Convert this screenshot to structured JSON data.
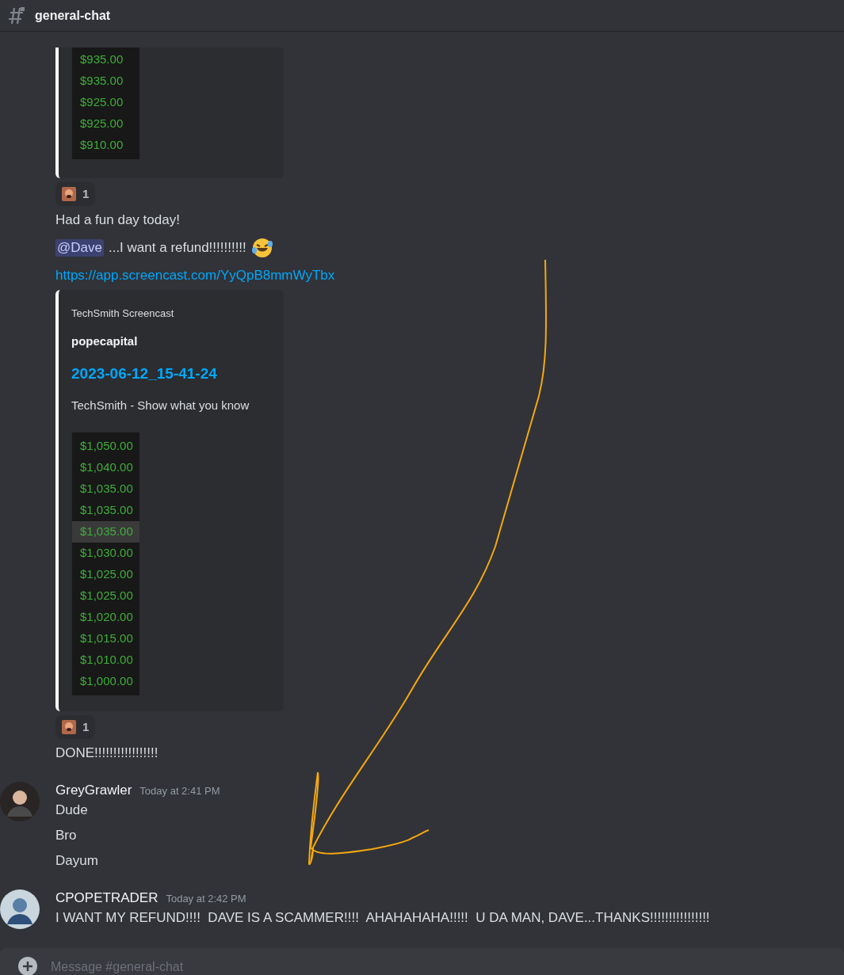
{
  "channel": {
    "name": "general-chat"
  },
  "messages": [
    {
      "continued": true,
      "items": [
        {
          "kind": "price_image",
          "cut_top": true,
          "prices": [
            {
              "text": "$935.00",
              "highlighted": false
            },
            {
              "text": "$935.00",
              "highlighted": false
            },
            {
              "text": "$925.00",
              "highlighted": false
            },
            {
              "text": "$925.00",
              "highlighted": false
            },
            {
              "text": "$910.00",
              "highlighted": false
            }
          ]
        },
        {
          "kind": "reaction",
          "count": "1"
        },
        {
          "kind": "text",
          "text": "Had a fun day today!"
        },
        {
          "kind": "mention_text",
          "mention": "@Dave",
          "text": "...I want a refund!!!!!!!!!!"
        },
        {
          "kind": "link",
          "text": "https://app.screencast.com/YyQpB8mmWyTbx"
        },
        {
          "kind": "link_embed",
          "provider": "TechSmith Screencast",
          "author": "popecapital",
          "title": "2023-06-12_15-41-24",
          "description": "TechSmith - Show what you know",
          "prices": [
            {
              "text": "$1,050.00",
              "highlighted": false
            },
            {
              "text": "$1,040.00",
              "highlighted": false
            },
            {
              "text": "$1,035.00",
              "highlighted": false
            },
            {
              "text": "$1,035.00",
              "highlighted": false
            },
            {
              "text": "$1,035.00",
              "highlighted": true
            },
            {
              "text": "$1,030.00",
              "highlighted": false
            },
            {
              "text": "$1,025.00",
              "highlighted": false
            },
            {
              "text": "$1,025.00",
              "highlighted": false
            },
            {
              "text": "$1,020.00",
              "highlighted": false
            },
            {
              "text": "$1,015.00",
              "highlighted": false
            },
            {
              "text": "$1,010.00",
              "highlighted": false
            },
            {
              "text": "$1,000.00",
              "highlighted": false
            }
          ]
        },
        {
          "kind": "reaction",
          "count": "1"
        },
        {
          "kind": "text",
          "text": "DONE!!!!!!!!!!!!!!!!!"
        }
      ]
    },
    {
      "continued": false,
      "author": "GreyGrawler",
      "time": "Today at 2:41 PM",
      "items": [
        {
          "kind": "text",
          "text": "Dude"
        },
        {
          "kind": "text",
          "text": "Bro"
        },
        {
          "kind": "text",
          "text": "Dayum"
        }
      ]
    },
    {
      "continued": false,
      "author": "CPOPETRADER",
      "time": "Today at 2:42 PM",
      "items": [
        {
          "kind": "text",
          "text": "I WANT MY REFUND!!!!  DAVE IS A SCAMMER!!!!  AHAHAHAHA!!!!!  U DA MAN, DAVE...THANKS!!!!!!!!!!!!!!!!"
        }
      ]
    }
  ],
  "composer": {
    "placeholder": "Message #general-chat"
  }
}
